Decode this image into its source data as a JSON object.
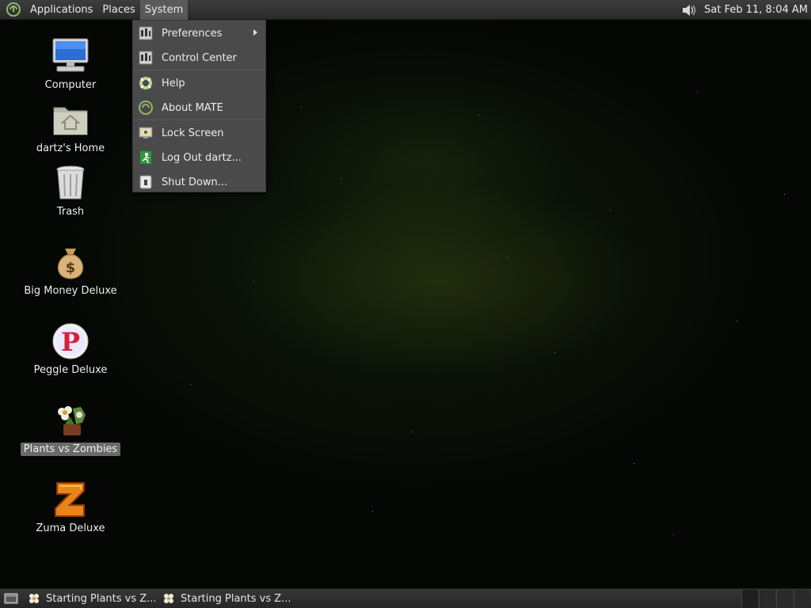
{
  "top_panel": {
    "menus": [
      "Applications",
      "Places",
      "System"
    ],
    "active_menu": "System",
    "clock": "Sat Feb 11,  8:04 AM"
  },
  "system_menu": {
    "items": [
      {
        "label": "Preferences",
        "icon": "preferences-icon",
        "submenu": true
      },
      {
        "label": "Control Center",
        "icon": "control-center-icon"
      },
      {
        "label": "Help",
        "icon": "help-lifebuoy-icon"
      },
      {
        "label": "About MATE",
        "icon": "mate-logo-icon"
      },
      {
        "label": "Lock Screen",
        "icon": "lock-screen-icon"
      },
      {
        "label": "Log Out dartz...",
        "icon": "log-out-icon"
      },
      {
        "label": "Shut Down...",
        "icon": "shut-down-icon"
      }
    ]
  },
  "desktop_icons": [
    {
      "label": "Computer",
      "icon": "computer-icon"
    },
    {
      "label": "dartz's Home",
      "icon": "home-folder-icon"
    },
    {
      "label": "Trash",
      "icon": "trash-icon"
    },
    {
      "label": "Big Money Deluxe",
      "icon": "money-bag-icon"
    },
    {
      "label": "Peggle Deluxe",
      "icon": "peggle-icon"
    },
    {
      "label": "Plants vs Zombies",
      "icon": "plants-vs-zombies-icon",
      "selected": true
    },
    {
      "label": "Zuma Deluxe",
      "icon": "zuma-icon"
    }
  ],
  "taskbar": {
    "tasks": [
      {
        "label": "Starting Plants vs Z...",
        "icon": "flower-icon"
      },
      {
        "label": "Starting Plants vs Z...",
        "icon": "flower-icon"
      }
    ]
  },
  "colors": {
    "panel": "#2e2e2e",
    "menu_bg": "#4a4a4a",
    "selection": "#6a6a6a"
  }
}
